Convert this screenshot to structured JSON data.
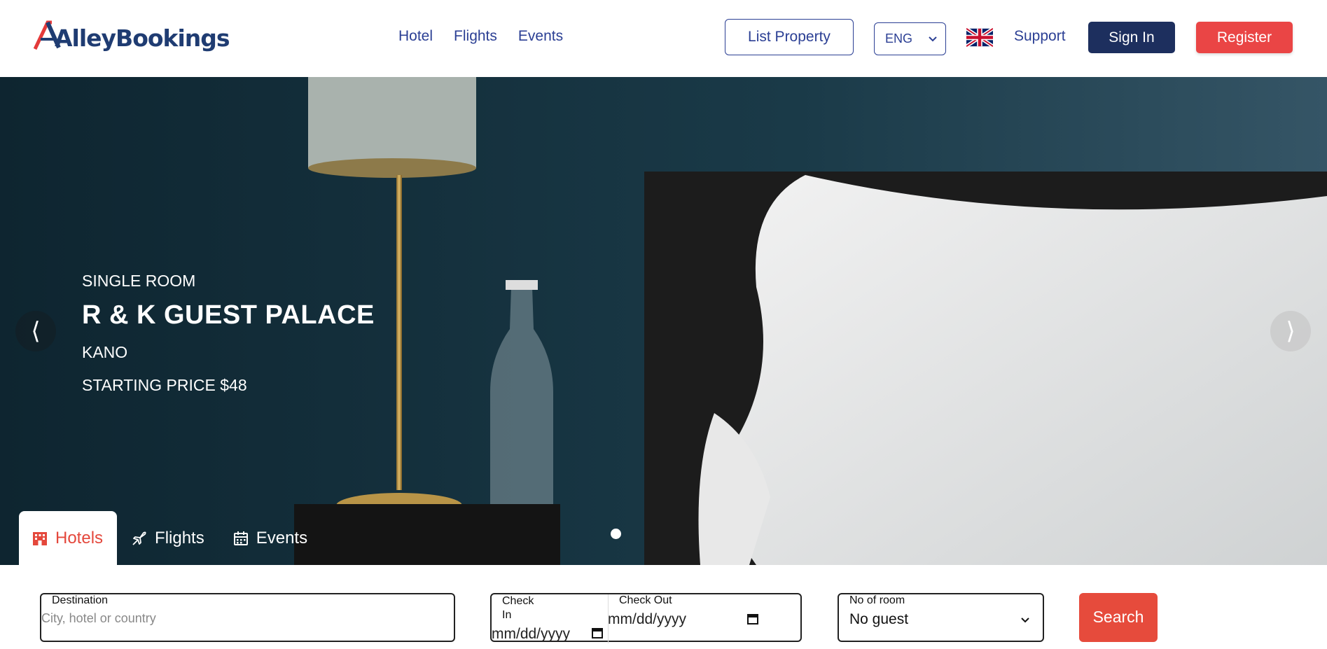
{
  "brand": {
    "logo_text": "AlleyBookings",
    "primary": "#2b3f94",
    "navy": "#1d2f5e",
    "accent": "#ea4545"
  },
  "nav": {
    "items": [
      "Hotel",
      "Flights",
      "Events"
    ]
  },
  "header": {
    "list_property": "List Property",
    "language": "ENG",
    "flag_icon": "uk-flag-icon",
    "support": "Support",
    "sign_in": "Sign In",
    "register": "Register"
  },
  "hero": {
    "room_type": "SINGLE ROOM",
    "hotel_name": "R & K GUEST PALACE",
    "city": "KANO",
    "price": "STARTING PRICE $48",
    "prev_icon": "chevron-left-icon",
    "next_icon": "chevron-right-icon"
  },
  "search_tabs": [
    {
      "label": "Hotels",
      "icon": "hotel-icon",
      "active": true
    },
    {
      "label": "Flights",
      "icon": "plane-icon",
      "active": false
    },
    {
      "label": "Events",
      "icon": "calendar-icon",
      "active": false
    }
  ],
  "search": {
    "destination_label": "Destination",
    "destination_placeholder": "City, hotel or country",
    "checkin_label": "Check In",
    "checkin_value": "mm/dd/yyyy",
    "checkout_label": "Check Out",
    "checkout_value": "mm/dd/yyyy",
    "rooms_label": "No of room",
    "rooms_value": "No guest",
    "search_button": "Search"
  }
}
